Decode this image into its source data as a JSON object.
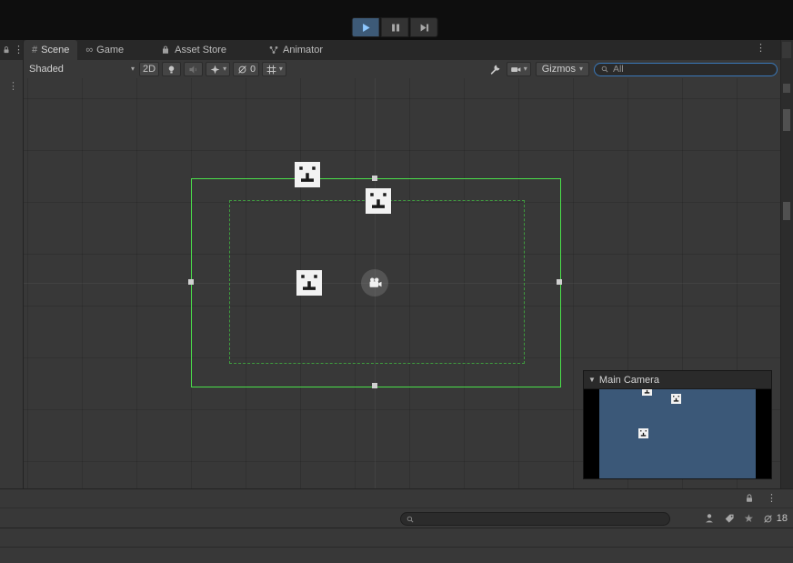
{
  "colors": {
    "selection_green": "#4ae04a",
    "dashed_green": "#3f9b3f",
    "camera_bg_blue": "#3b5878",
    "search_focus_blue": "#3a79bb",
    "play_active_bg": "#3d5a77"
  },
  "playbar": {
    "play_icon": "play",
    "pause_icon": "pause",
    "step_icon": "step-forward"
  },
  "tabs": [
    {
      "label": "Scene",
      "icon": "#",
      "active": true
    },
    {
      "label": "Game",
      "icon": "∞",
      "active": false
    },
    {
      "label": "Asset Store",
      "icon": "bag",
      "active": false
    },
    {
      "label": "Animator",
      "icon": "state-machine",
      "active": false
    }
  ],
  "tab_overflow_icon": "⋮",
  "left_edge": {
    "kebab": "⋮"
  },
  "scene_toolbar": {
    "draw_mode_label": "Shaded",
    "caret": "▾",
    "mode_2d_label": "2D",
    "hidden_count": "0",
    "gizmos_label": "Gizmos",
    "search_value": "All"
  },
  "camera_preview": {
    "foldout": "▼",
    "title": "Main Camera"
  },
  "bottom": {
    "kebab": "⋮",
    "star": "★",
    "hidden_count": "18",
    "search_value": ""
  }
}
